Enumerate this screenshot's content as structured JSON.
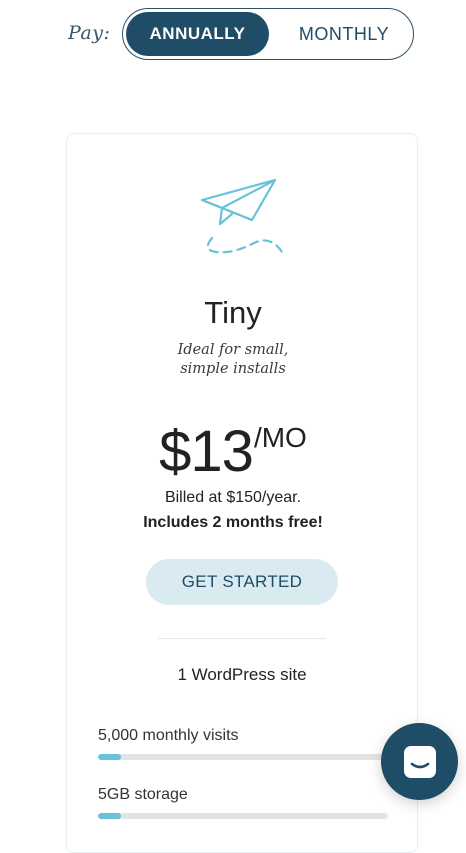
{
  "pay_toggle": {
    "label": "Pay:",
    "options": [
      "ANNUALLY",
      "MONTHLY"
    ],
    "selected": "ANNUALLY"
  },
  "plan": {
    "name": "Tiny",
    "description_line1": "Ideal for small,",
    "description_line2": "simple installs",
    "price": "$13",
    "period": "/MO",
    "billed": "Billed at $150/year.",
    "includes": "Includes 2 months free!",
    "cta_label": "GET STARTED",
    "sites": "1 WordPress site",
    "usage": [
      {
        "label": "5,000 monthly visits",
        "fill_fraction": 0.08
      },
      {
        "label": "5GB storage",
        "fill_fraction": 0.08
      }
    ]
  },
  "icons": {
    "plan_icon": "paper-plane-icon",
    "chat_icon": "chat-icon"
  },
  "colors": {
    "primary": "#1f4c66",
    "accent": "#68c2d9",
    "cta_bg": "#d9ebf1"
  }
}
